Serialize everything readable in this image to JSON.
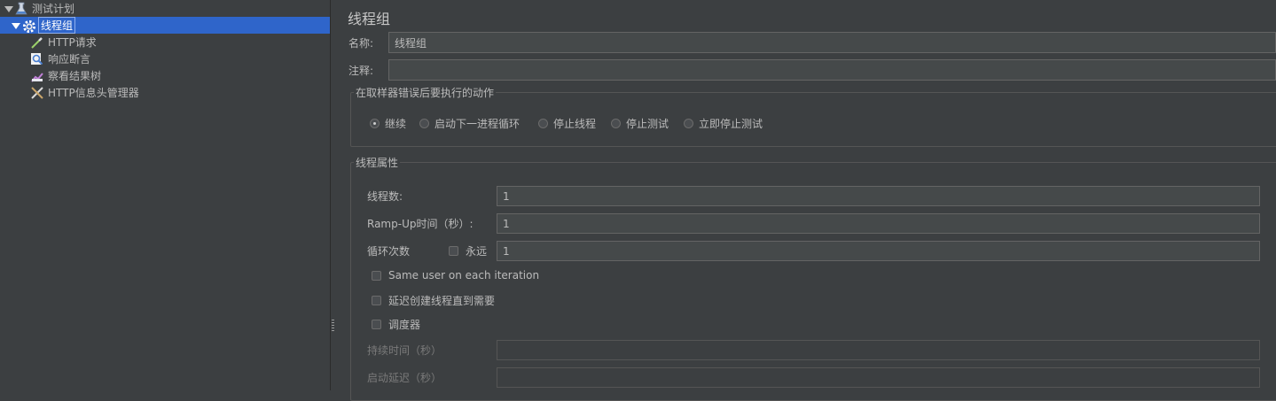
{
  "tree": {
    "root": {
      "label": "测试计划",
      "icon": "test-plan-icon"
    },
    "thread_group": {
      "label": "线程组",
      "icon": "gear-icon"
    },
    "children": [
      {
        "label": "HTTP请求",
        "icon": "pipette-icon"
      },
      {
        "label": "响应断言",
        "icon": "magnifier-icon"
      },
      {
        "label": "察看结果树",
        "icon": "chart-icon"
      },
      {
        "label": "HTTP信息头管理器",
        "icon": "tools-icon"
      }
    ]
  },
  "panel": {
    "title": "线程组",
    "name_label": "名称:",
    "name_value": "线程组",
    "comment_label": "注释:",
    "comment_value": "",
    "error_action": {
      "legend": "在取样器错误后要执行的动作",
      "options": [
        "继续",
        "启动下一进程循环",
        "停止线程",
        "停止测试",
        "立即停止测试"
      ],
      "selected": "继续"
    },
    "thread_props": {
      "legend": "线程属性",
      "threads_label": "线程数:",
      "threads_value": "1",
      "rampup_label": "Ramp-Up时间（秒）:",
      "rampup_value": "1",
      "loop_label": "循环次数",
      "forever_label": "永远",
      "forever_checked": false,
      "loop_value": "1",
      "same_user_label": "Same user on each iteration",
      "same_user_checked": false,
      "delay_label": "延迟创建线程直到需要",
      "delay_checked": false,
      "scheduler_label": "调度器",
      "scheduler_checked": false,
      "duration_label": "持续时间（秒）",
      "duration_value": "",
      "startup_delay_label": "启动延迟（秒）",
      "startup_delay_value": ""
    }
  },
  "colors": {
    "background": "#3c3f41",
    "selection": "#2f65ca",
    "text": "#bbbbbb"
  }
}
